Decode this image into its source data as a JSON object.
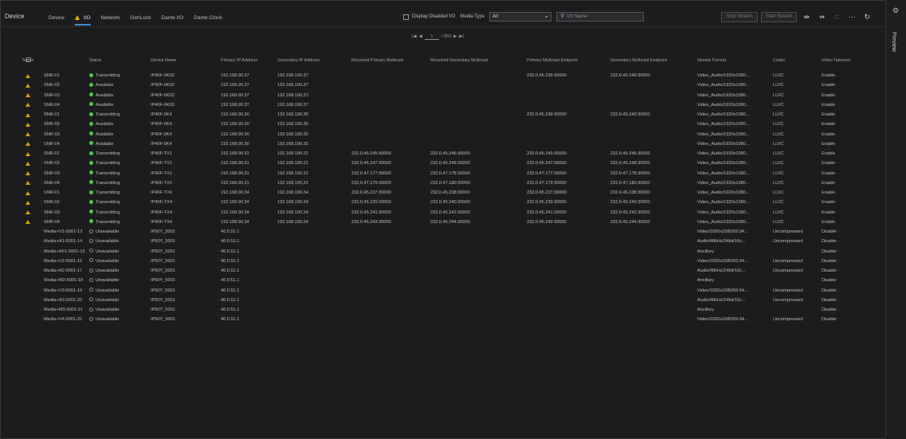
{
  "device_title": "Device",
  "tabs": [
    {
      "label": "Device",
      "warn": false,
      "active": false
    },
    {
      "label": "I/O",
      "warn": true,
      "active": true
    },
    {
      "label": "Network",
      "warn": false,
      "active": false
    },
    {
      "label": "GenLock",
      "warn": false,
      "active": false
    },
    {
      "label": "Dante I/O",
      "warn": false,
      "active": false
    },
    {
      "label": "Dante Clock",
      "warn": false,
      "active": false
    }
  ],
  "toolbar": {
    "display_checkbox_label": "Display Disabled I/O",
    "media_type_label": "Media Type",
    "media_type_value": "All",
    "search_placeholder": "I/O Name",
    "buttons": [
      "Stop Stream",
      "Start Stream"
    ]
  },
  "preview_label": "Preview",
  "pager": {
    "first": "|◀",
    "prev": "◀",
    "page": "1",
    "total": "/ 859",
    "next": "▶",
    "last": "▶|"
  },
  "columns": [
    "Name",
    "Status",
    "Device Name",
    "Primary IP Address",
    "Secondary IP Address",
    "Received Primary Multicast",
    "Received Secondary Multicast",
    "Primary Multicast Endpoint",
    "Secondary Multicast Endpoint",
    "Stream Format",
    "Codec",
    "Video Takeover"
  ],
  "rows": [
    {
      "warn": true,
      "name": "SNR-01",
      "status": "Transmitting",
      "dot": "green",
      "device": "IP40F-0K02",
      "pip": "192.168.90.37",
      "sip": "192.168.190.37",
      "rpm": "",
      "rsm": "",
      "pme": "232.0.45.239:30000",
      "sme": "232.0.45.240:30000",
      "fmt": "Video_Audio/1920x1080...",
      "codec": "LLVC",
      "vt": "Enable"
    },
    {
      "warn": true,
      "name": "SNR-02",
      "status": "Available",
      "dot": "green",
      "device": "IP40F-0K02",
      "pip": "192.168.90.37",
      "sip": "192.168.190.37",
      "rpm": "",
      "rsm": "",
      "pme": "",
      "sme": "",
      "fmt": "Video_Audio/1920x1080...",
      "codec": "LLVC",
      "vt": "Enable"
    },
    {
      "warn": true,
      "name": "SNR-03",
      "status": "Available",
      "dot": "green",
      "device": "IP40F-0K02",
      "pip": "192.168.90.37",
      "sip": "192.168.190.37",
      "rpm": "",
      "rsm": "",
      "pme": "",
      "sme": "",
      "fmt": "Video_Audio/1920x1080...",
      "codec": "LLVC",
      "vt": "Enable"
    },
    {
      "warn": true,
      "name": "SNR-04",
      "status": "Available",
      "dot": "green",
      "device": "IP40F-0K02",
      "pip": "192.168.90.37",
      "sip": "192.168.190.37",
      "rpm": "",
      "rsm": "",
      "pme": "",
      "sme": "",
      "fmt": "Video_Audio/1920x1080...",
      "codec": "LLVC",
      "vt": "Enable"
    },
    {
      "warn": true,
      "name": "SNR-01",
      "status": "Transmitting",
      "dot": "green",
      "device": "IP40F-0K4",
      "pip": "192.168.90.30",
      "sip": "192.168.190.30",
      "rpm": "",
      "rsm": "",
      "pme": "232.0.45.239:30000",
      "sme": "232.0.45.240:30000",
      "fmt": "Video_Audio/1920x1080...",
      "codec": "LLVC",
      "vt": "Enable"
    },
    {
      "warn": true,
      "name": "SNR-02",
      "status": "Available",
      "dot": "green",
      "device": "IP40F-0K4",
      "pip": "192.168.90.30",
      "sip": "192.168.190.30",
      "rpm": "",
      "rsm": "",
      "pme": "",
      "sme": "",
      "fmt": "Video_Audio/1920x1080...",
      "codec": "LLVC",
      "vt": "Enable"
    },
    {
      "warn": true,
      "name": "SNR-03",
      "status": "Available",
      "dot": "green",
      "device": "IP40F-0K4",
      "pip": "192.168.90.30",
      "sip": "192.168.190.30",
      "rpm": "",
      "rsm": "",
      "pme": "",
      "sme": "",
      "fmt": "Video_Audio/1920x1080...",
      "codec": "LLVC",
      "vt": "Enable"
    },
    {
      "warn": true,
      "name": "SNR-04",
      "status": "Available",
      "dot": "green",
      "device": "IP40F-0K4",
      "pip": "192.168.90.30",
      "sip": "192.168.190.30",
      "rpm": "",
      "rsm": "",
      "pme": "",
      "sme": "",
      "fmt": "Video_Audio/1920x1080...",
      "codec": "LLVC",
      "vt": "Enable"
    },
    {
      "warn": true,
      "name": "SNR-01",
      "status": "Transmitting",
      "dot": "green",
      "device": "IP40F-TX1",
      "pip": "192.168.90.31",
      "sip": "192.168.190.31",
      "rpm": "232.0.45.245:30000",
      "rsm": "232.0.45.246:30000",
      "pme": "232.0.45.245:30000",
      "sme": "232.0.45.246:30000",
      "fmt": "Video_Audio/1920x1080...",
      "codec": "LLVC",
      "vt": "Enable"
    },
    {
      "warn": true,
      "name": "SNR-02",
      "status": "Transmitting",
      "dot": "green",
      "device": "IP40F-TX1",
      "pip": "192.168.90.31",
      "sip": "192.168.190.31",
      "rpm": "232.0.45.247:30000",
      "rsm": "232.0.45.248:30000",
      "pme": "232.0.45.247:30000",
      "sme": "232.0.45.248:30000",
      "fmt": "Video_Audio/1920x1080...",
      "codec": "LLVC",
      "vt": "Enable"
    },
    {
      "warn": true,
      "name": "SNR-03",
      "status": "Transmitting",
      "dot": "green",
      "device": "IP40F-TX1",
      "pip": "192.168.90.31",
      "sip": "192.168.190.31",
      "rpm": "232.0.47.177:30000",
      "rsm": "232.0.47.178:30000",
      "pme": "232.0.47.177:30000",
      "sme": "232.0.47.178:30000",
      "fmt": "Video_Audio/1920x1080...",
      "codec": "LLVC",
      "vt": "Enable"
    },
    {
      "warn": true,
      "name": "SNR-04",
      "status": "Transmitting",
      "dot": "green",
      "device": "IP40F-TX1",
      "pip": "192.168.90.31",
      "sip": "192.168.190.31",
      "rpm": "232.0.47.179:30000",
      "rsm": "232.0.47.180:30000",
      "pme": "232.0.47.179:30000",
      "sme": "232.0.47.180:30000",
      "fmt": "Video_Audio/1920x1080...",
      "codec": "LLVC",
      "vt": "Enable"
    },
    {
      "warn": true,
      "name": "SNR-01",
      "status": "Transmitting",
      "dot": "green",
      "device": "IP40F-TX4",
      "pip": "192.168.90.34",
      "sip": "192.168.190.34",
      "rpm": "232.0.45.237:30000",
      "rsm": "232.0.45.238:30000",
      "pme": "232.0.45.237:30000",
      "sme": "232.0.45.238:30000",
      "fmt": "Video_Audio/1920x1080...",
      "codec": "LLVC",
      "vt": "Enable"
    },
    {
      "warn": true,
      "name": "SNR-02",
      "status": "Transmitting",
      "dot": "green",
      "device": "IP40F-TX4",
      "pip": "192.168.90.34",
      "sip": "192.168.190.34",
      "rpm": "232.0.45.239:30000",
      "rsm": "232.0.45.240:30000",
      "pme": "232.0.45.239:30000",
      "sme": "232.0.45.240:30000",
      "fmt": "Video_Audio/1920x1080...",
      "codec": "LLVC",
      "vt": "Enable"
    },
    {
      "warn": true,
      "name": "SNR-03",
      "status": "Transmitting",
      "dot": "green",
      "device": "IP40F-TX4",
      "pip": "192.168.90.34",
      "sip": "192.168.190.34",
      "rpm": "232.0.45.241:30000",
      "rsm": "232.0.45.242:30000",
      "pme": "232.0.45.241:30000",
      "sme": "232.0.45.242:30000",
      "fmt": "Video_Audio/1920x1080...",
      "codec": "LLVC",
      "vt": "Enable"
    },
    {
      "warn": true,
      "name": "SNR-04",
      "status": "Transmitting",
      "dot": "green",
      "device": "IP40F-TX4",
      "pip": "192.168.90.34",
      "sip": "192.168.190.34",
      "rpm": "232.0.45.243:30000",
      "rsm": "232.0.45.244:30000",
      "pme": "232.0.45.243:30000",
      "sme": "232.0.45.244:30000",
      "fmt": "Video_Audio/1920x1080...",
      "codec": "LLVC",
      "vt": "Enable"
    },
    {
      "warn": false,
      "name": "Media-rV1-5001-13",
      "status": "Unavailable",
      "dot": "grey",
      "device": "IP50Y_5001",
      "pip": "40.0.51.1",
      "sip": "",
      "rpm": "",
      "rsm": "",
      "pme": "",
      "sme": "",
      "fmt": "Video/1920x1080/59.94...",
      "codec": "Uncompressed",
      "vt": "Disable"
    },
    {
      "warn": false,
      "name": "Media-rA1-5001-14",
      "status": "Unavailable",
      "dot": "grey",
      "device": "IP50Y_5001",
      "pip": "40.0.51.1",
      "sip": "",
      "rpm": "",
      "rsm": "",
      "pme": "",
      "sme": "",
      "fmt": "Audio/48kHz/24bit/16c...",
      "codec": "Uncompressed",
      "vt": "Disable"
    },
    {
      "warn": false,
      "name": "Media-rAF1-5001-15",
      "status": "Unavailable",
      "dot": "grey",
      "device": "IP50Y_5001",
      "pip": "40.0.51.1",
      "sip": "",
      "rpm": "",
      "rsm": "",
      "pme": "",
      "sme": "",
      "fmt": "Ancillary",
      "codec": "",
      "vt": "Disable"
    },
    {
      "warn": false,
      "name": "Media-rV2-5001-16",
      "status": "Unavailable",
      "dot": "grey",
      "device": "IP50Y_5001",
      "pip": "40.0.51.1",
      "sip": "",
      "rpm": "",
      "rsm": "",
      "pme": "",
      "sme": "",
      "fmt": "Video/1920x1080/59.94...",
      "codec": "Uncompressed",
      "vt": "Disable"
    },
    {
      "warn": false,
      "name": "Media-rA2-5001-17",
      "status": "Unavailable",
      "dot": "grey",
      "device": "IP50Y_5001",
      "pip": "40.0.51.1",
      "sip": "",
      "rpm": "",
      "rsm": "",
      "pme": "",
      "sme": "",
      "fmt": "Audio/48kHz/24bit/16c...",
      "codec": "Uncompressed",
      "vt": "Disable"
    },
    {
      "warn": false,
      "name": "Media-rM2-5001-18",
      "status": "Unavailable",
      "dot": "grey",
      "device": "IP50Y_5001",
      "pip": "40.0.51.1",
      "sip": "",
      "rpm": "",
      "rsm": "",
      "pme": "",
      "sme": "",
      "fmt": "Ancillary",
      "codec": "",
      "vt": "Disable"
    },
    {
      "warn": false,
      "name": "Media-rV3-5001-19",
      "status": "Unavailable",
      "dot": "grey",
      "device": "IP50Y_5001",
      "pip": "40.0.51.1",
      "sip": "",
      "rpm": "",
      "rsm": "",
      "pme": "",
      "sme": "",
      "fmt": "Video/1920x1080/59.94...",
      "codec": "Uncompressed",
      "vt": "Disable"
    },
    {
      "warn": false,
      "name": "Media-rA3-5001-20",
      "status": "Unavailable",
      "dot": "grey",
      "device": "IP50Y_5001",
      "pip": "40.0.51.1",
      "sip": "",
      "rpm": "",
      "rsm": "",
      "pme": "",
      "sme": "",
      "fmt": "Audio/48kHz/24bit/16c...",
      "codec": "Uncompressed",
      "vt": "Disable"
    },
    {
      "warn": false,
      "name": "Media-rM3-5001-21",
      "status": "Unavailable",
      "dot": "grey",
      "device": "IP50Y_5001",
      "pip": "40.0.51.1",
      "sip": "",
      "rpm": "",
      "rsm": "",
      "pme": "",
      "sme": "",
      "fmt": "Ancillary",
      "codec": "",
      "vt": "Disable"
    },
    {
      "warn": false,
      "name": "Media-rV4-5001-22",
      "status": "Unavailable",
      "dot": "grey",
      "device": "IP50Y_5001",
      "pip": "40.0.51.1",
      "sip": "",
      "rpm": "",
      "rsm": "",
      "pme": "",
      "sme": "",
      "fmt": "Video/1920x1080/59.94...",
      "codec": "Uncompressed",
      "vt": "Disable"
    }
  ]
}
